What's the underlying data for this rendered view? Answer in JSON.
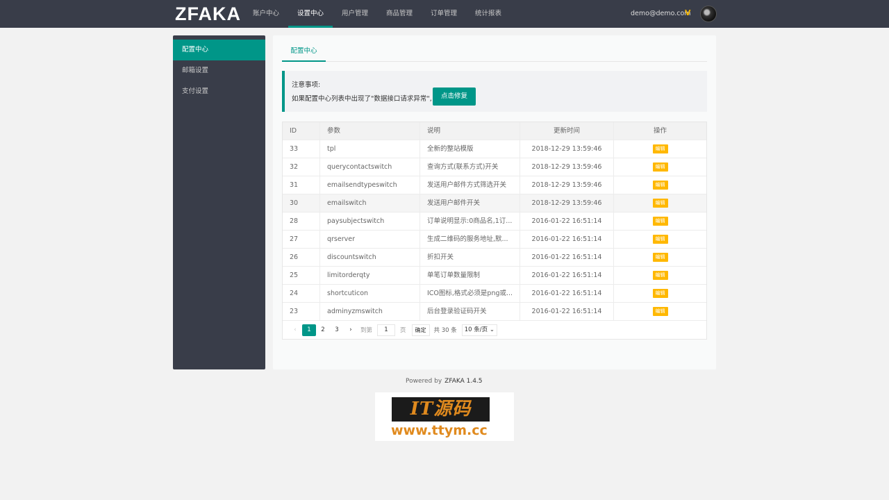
{
  "header": {
    "logo": "ZFAKA",
    "nav": [
      {
        "label": "账户中心"
      },
      {
        "label": "设置中心"
      },
      {
        "label": "用户管理"
      },
      {
        "label": "商品管理"
      },
      {
        "label": "订单管理"
      },
      {
        "label": "统计报表"
      }
    ],
    "active_nav": "设置中心",
    "user_email": "demo@demo.com",
    "vip_badge": "V"
  },
  "sidebar": {
    "items": [
      {
        "label": "配置中心"
      },
      {
        "label": "邮箱设置"
      },
      {
        "label": "支付设置"
      }
    ],
    "active": "配置中心"
  },
  "main": {
    "tab": "配置中心",
    "notice": {
      "title": "注意事项:",
      "text": "如果配置中心列表中出现了\"数据接口请求异常\",",
      "button": "点击修复"
    },
    "table": {
      "headers": {
        "id": "ID",
        "key": "参数",
        "desc": "说明",
        "time": "更新时间",
        "op": "操作"
      },
      "edit_label": "编辑",
      "rows": [
        {
          "id": "33",
          "key": "tpl",
          "desc": "全新的整站模版",
          "time": "2018-12-29 13:59:46"
        },
        {
          "id": "32",
          "key": "querycontactswitch",
          "desc": "查询方式(联系方式)开关",
          "time": "2018-12-29 13:59:46"
        },
        {
          "id": "31",
          "key": "emailsendtypeswitch",
          "desc": "发送用户邮件方式筛选开关",
          "time": "2018-12-29 13:59:46"
        },
        {
          "id": "30",
          "key": "emailswitch",
          "desc": "发送用户邮件开关",
          "time": "2018-12-29 13:59:46"
        },
        {
          "id": "28",
          "key": "paysubjectswitch",
          "desc": "订单说明显示:0商品名,1订...",
          "time": "2016-01-22 16:51:14"
        },
        {
          "id": "27",
          "key": "qrserver",
          "desc": "生成二维码的服务地址,默...",
          "time": "2016-01-22 16:51:14"
        },
        {
          "id": "26",
          "key": "discountswitch",
          "desc": "折扣开关",
          "time": "2016-01-22 16:51:14"
        },
        {
          "id": "25",
          "key": "limitorderqty",
          "desc": "单笔订单数量限制",
          "time": "2016-01-22 16:51:14"
        },
        {
          "id": "24",
          "key": "shortcuticon",
          "desc": "ICO图标,格式必须是png或...",
          "time": "2016-01-22 16:51:14"
        },
        {
          "id": "23",
          "key": "adminyzmswitch",
          "desc": "后台登录验证码开关",
          "time": "2016-01-22 16:51:14"
        }
      ],
      "highlighted_row_id": "30"
    },
    "pager": {
      "prev": "‹",
      "pages": [
        "1",
        "2",
        "3"
      ],
      "current": "1",
      "next": "›",
      "goto_label": "到第",
      "goto_value": "1",
      "page_unit": "页",
      "confirm": "确定",
      "total": "共 30 条",
      "page_size": "10 条/页"
    }
  },
  "footer": {
    "powered": "Powered by",
    "brand": "ZFAKA 1.4.5"
  },
  "watermark": {
    "line1": "IT源码",
    "line2": "www.ttym.cc"
  },
  "colors": {
    "header_bg": "#393D49",
    "accent": "#009688",
    "edit_button": "#FFB800"
  }
}
